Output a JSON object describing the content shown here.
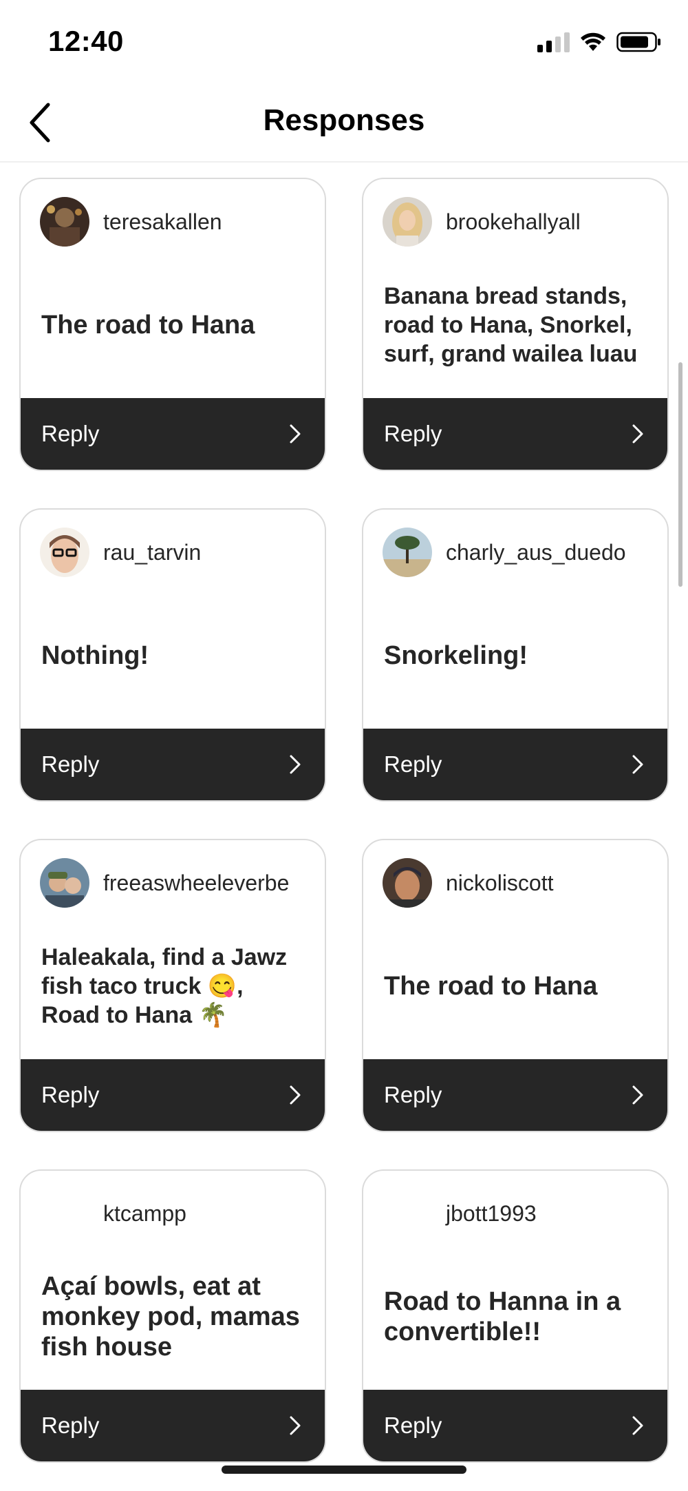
{
  "status_bar": {
    "time": "12:40",
    "icons": [
      "cellular-signal-icon",
      "wifi-icon",
      "battery-icon"
    ]
  },
  "header": {
    "title": "Responses",
    "back_icon": "chevron-left-icon"
  },
  "colors": {
    "reply_bar": "#262626",
    "card_border": "#dbdbdb",
    "text": "#262626"
  },
  "responses": [
    {
      "username": "teresakallen",
      "text": "The road to Hana",
      "reply_label": "Reply"
    },
    {
      "username": "brookehallyall",
      "text": "Banana bread stands, road to Hana, Snorkel, surf, grand wailea luau",
      "reply_label": "Reply"
    },
    {
      "username": "rau_tarvin",
      "text": "Nothing!",
      "reply_label": "Reply"
    },
    {
      "username": "charly_aus_duedo",
      "text": "Snorkeling!",
      "reply_label": "Reply"
    },
    {
      "username": "freeaswheeleverbe",
      "text": "Haleakala, find a Jawz fish taco truck 😋, Road to Hana 🌴",
      "reply_label": "Reply"
    },
    {
      "username": "nickoliscott",
      "text": "The road to Hana",
      "reply_label": "Reply"
    },
    {
      "username": "ktcampp",
      "text": "Açaí bowls, eat at monkey pod, mamas fish house",
      "reply_label": "Reply"
    },
    {
      "username": "jbott1993",
      "text": "Road to Hanna in a convertible!!",
      "reply_label": "Reply"
    }
  ]
}
